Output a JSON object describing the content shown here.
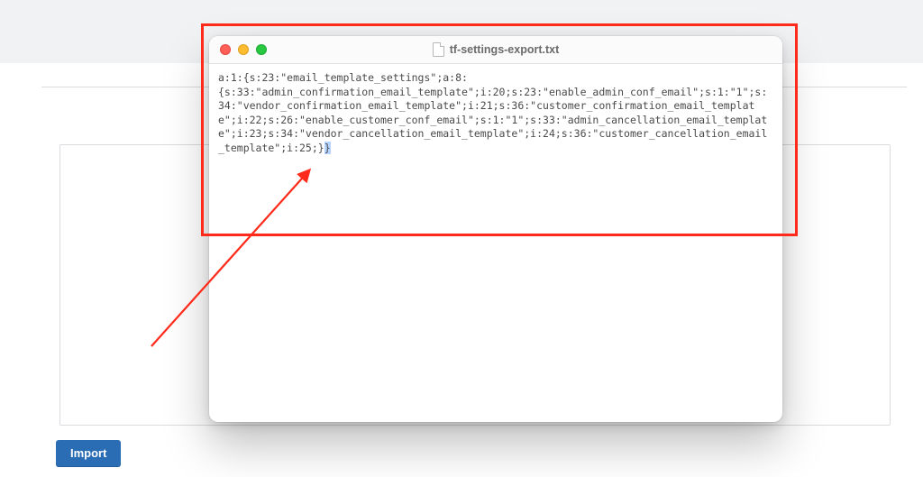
{
  "file_window": {
    "filename": "tf-settings-export.txt",
    "content": "a:1:{s:23:\"email_template_settings\";a:8:\n{s:33:\"admin_confirmation_email_template\";i:20;s:23:\"enable_admin_conf_email\";s:1:\"1\";s:34:\"vendor_confirmation_email_template\";i:21;s:36:\"customer_confirmation_email_template\";i:22;s:26:\"enable_customer_conf_email\";s:1:\"1\";s:33:\"admin_cancellation_email_template\";i:23;s:34:\"vendor_cancellation_email_template\";i:24;s:36:\"customer_cancellation_email_template\";i:25;}",
    "content_tail": "}"
  },
  "annotation": {
    "color": "#ff2a1a"
  },
  "buttons": {
    "import_label": "Import"
  }
}
